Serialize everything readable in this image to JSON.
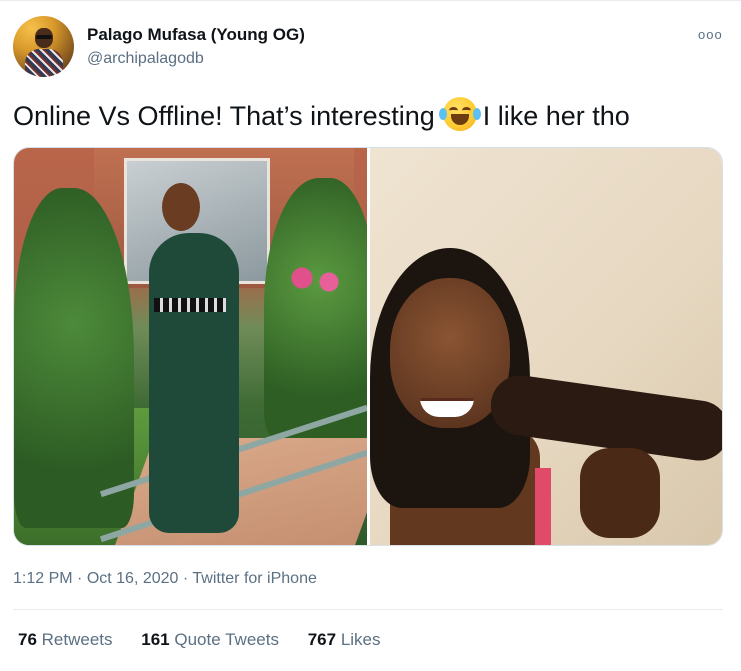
{
  "tweet": {
    "author": {
      "display_name": "Palago Mufasa (Young OG)",
      "handle": "@archipalagodb"
    },
    "more_label": "ooo",
    "text_before": "Online Vs Offline! That’s interesting",
    "text_after": "I like her tho",
    "emoji": "face-with-tears-of-joy",
    "time": "1:12 PM",
    "date": "Oct 16, 2020",
    "source": "Twitter for iPhone",
    "stats": {
      "retweets_count": "76",
      "retweets_label": "Retweets",
      "quote_count": "161",
      "quote_label": "Quote Tweets",
      "likes_count": "767",
      "likes_label": "Likes"
    }
  }
}
